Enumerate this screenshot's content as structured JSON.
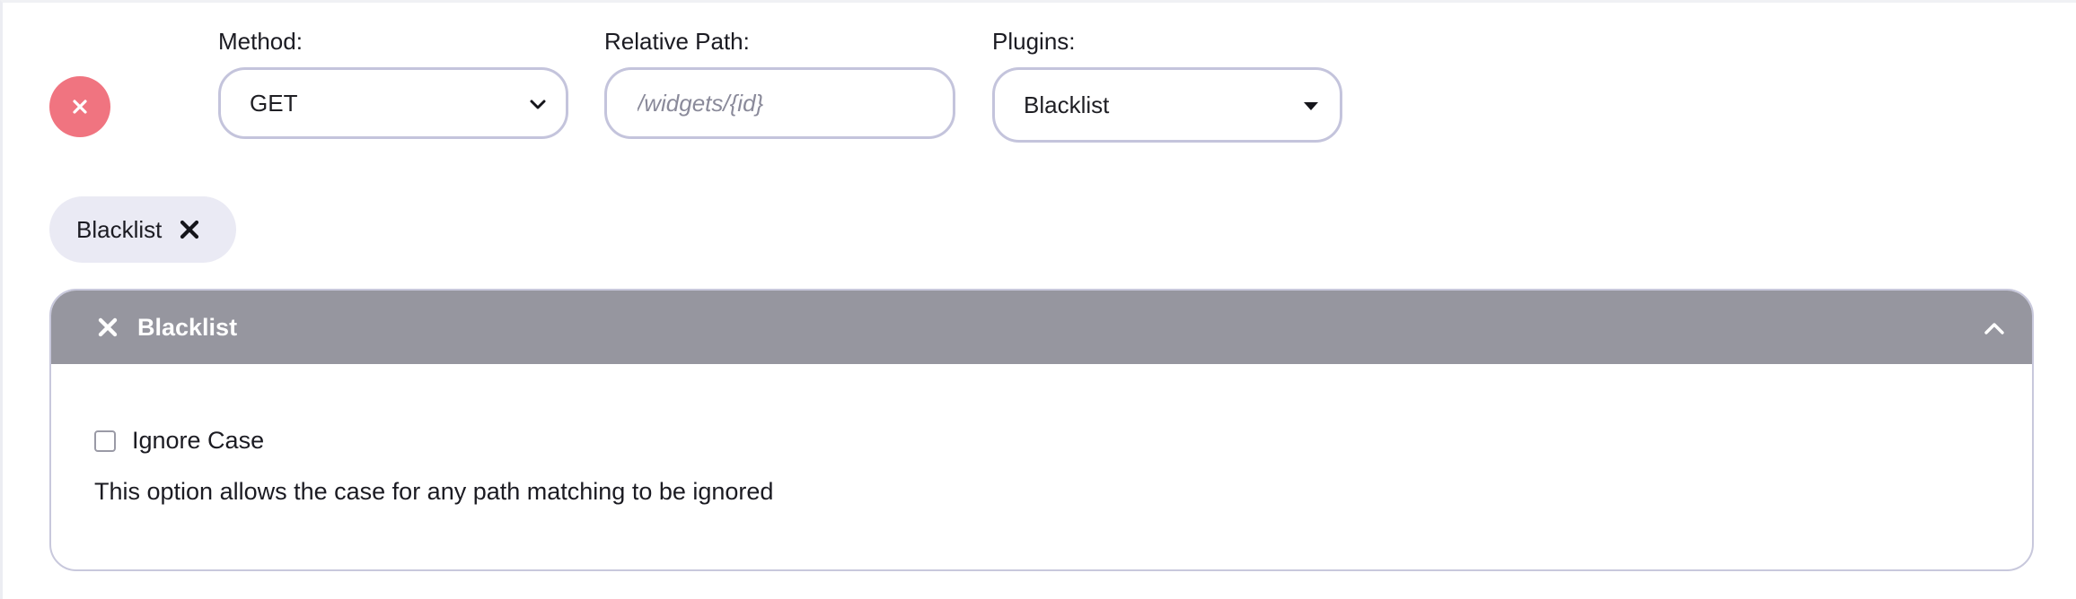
{
  "row": {
    "remove_icon": "close-icon",
    "remove_color": "#f07480"
  },
  "method": {
    "label": "Method:",
    "value": "GET"
  },
  "relative_path": {
    "label": "Relative Path:",
    "placeholder": "/widgets/{id}",
    "value": ""
  },
  "plugins": {
    "label": "Plugins:",
    "value": "Blacklist"
  },
  "selected_plugins": [
    {
      "label": "Blacklist"
    }
  ],
  "panel": {
    "title": "Blacklist",
    "header_color": "#96969f",
    "options": [
      {
        "label": "Ignore Case",
        "checked": false,
        "description": "This option allows the case for any path matching to be ignored"
      }
    ]
  }
}
